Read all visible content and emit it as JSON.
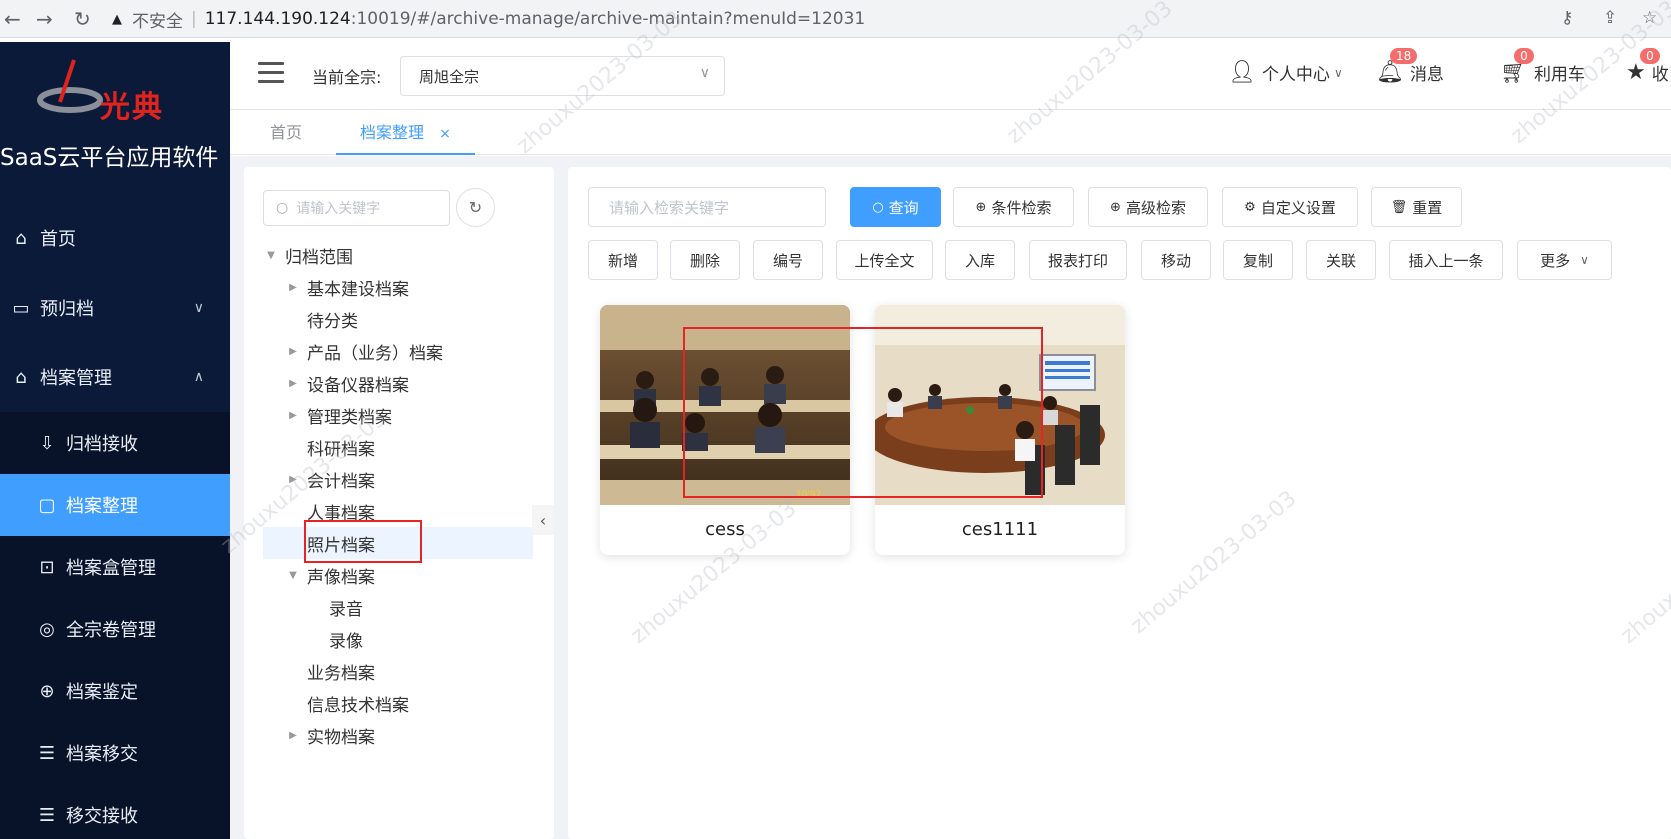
{
  "browser": {
    "warning_icon": "warning-icon",
    "insecure_label": "不安全",
    "separator": "|",
    "url_host": "117.144.190.124",
    "url_path": ":10019/#/archive-manage/archive-maintain?menuId=12031"
  },
  "sidebar": {
    "logo_text": "光典",
    "app_name": "SaaS云平台应用软件",
    "items": [
      {
        "label": "首页",
        "icon": "home-icon"
      },
      {
        "label": "预归档",
        "icon": "inbox-icon"
      },
      {
        "label": "档案管理",
        "icon": "bank-icon"
      },
      {
        "label": "归档接收",
        "icon": "receive-icon"
      },
      {
        "label": "档案整理",
        "icon": "folder-icon"
      },
      {
        "label": "档案盒管理",
        "icon": "box-icon"
      },
      {
        "label": "全宗卷管理",
        "icon": "circle-icon"
      },
      {
        "label": "档案鉴定",
        "icon": "compass-icon"
      },
      {
        "label": "档案移交",
        "icon": "list-icon"
      },
      {
        "label": "移交接收",
        "icon": "list-icon"
      }
    ]
  },
  "header": {
    "fonds_label": "当前全宗:",
    "fonds_value": "周旭全宗",
    "user_center": "个人中心",
    "messages": "消息",
    "messages_count": "18",
    "cart": "利用车",
    "cart_count": "0",
    "favorites": "收",
    "favorites_count": "0"
  },
  "tabs": [
    {
      "label": "首页"
    },
    {
      "label": "档案整理",
      "close": "×"
    }
  ],
  "tree": {
    "search_placeholder": "请输入关键字",
    "nodes": [
      {
        "label": "归档范围"
      },
      {
        "label": "基本建设档案"
      },
      {
        "label": "待分类"
      },
      {
        "label": "产品（业务）档案"
      },
      {
        "label": "设备仪器档案"
      },
      {
        "label": "管理类档案"
      },
      {
        "label": "科研档案"
      },
      {
        "label": "会计档案"
      },
      {
        "label": "人事档案"
      },
      {
        "label": "照片档案"
      },
      {
        "label": "声像档案"
      },
      {
        "label": "录音"
      },
      {
        "label": "录像"
      },
      {
        "label": "业务档案"
      },
      {
        "label": "信息技术档案"
      },
      {
        "label": "实物档案"
      }
    ]
  },
  "toolbar": {
    "search_placeholder": "请输入检索关键字",
    "query": "查询",
    "condition_search": "条件检索",
    "advanced_search": "高级检索",
    "custom_settings": "自定义设置",
    "reset": "重置",
    "actions": [
      "新增",
      "删除",
      "编号",
      "上传全文",
      "入库",
      "报表打印",
      "移动",
      "复制",
      "关联",
      "插入上一条"
    ],
    "more": "更多"
  },
  "cards": [
    {
      "caption": "cess"
    },
    {
      "caption": "ces1111"
    }
  ],
  "watermark": "zhouxu2023-03-03",
  "colors": {
    "sidebar_bg": "#0c1a3a",
    "active": "#409eff",
    "highlight": "#e52424"
  }
}
